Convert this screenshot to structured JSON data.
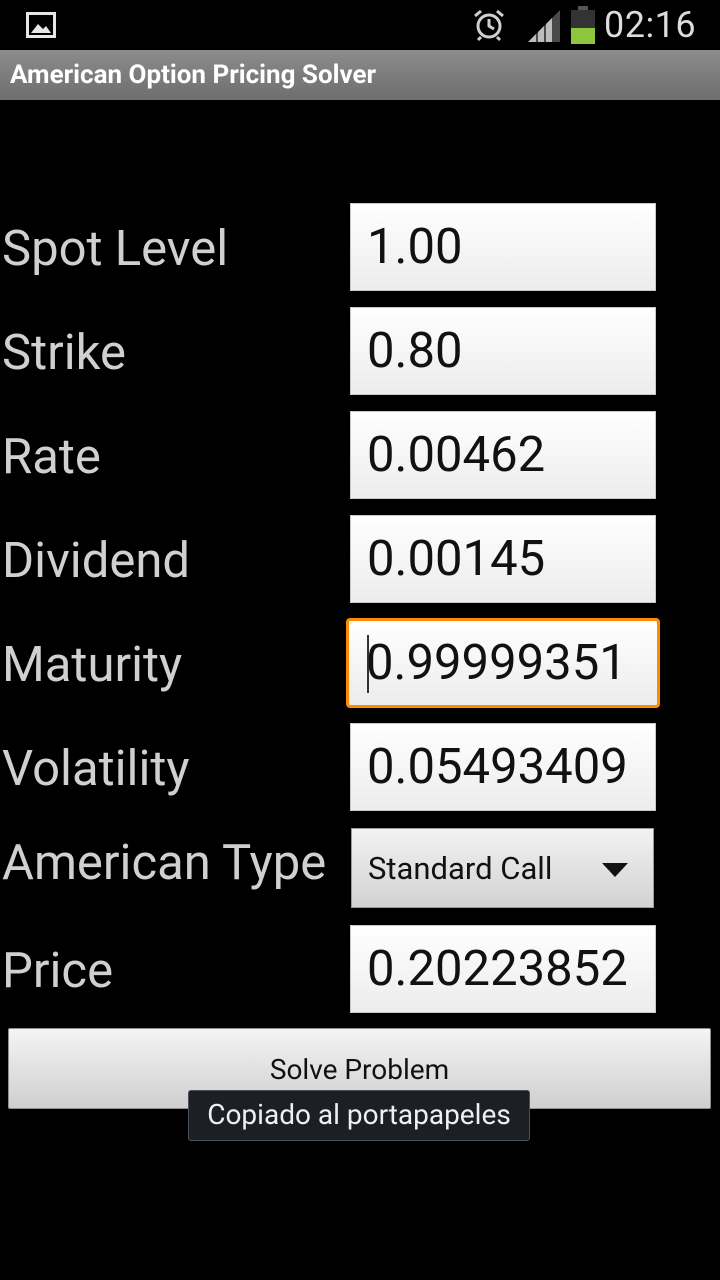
{
  "status_bar": {
    "time": "02:16",
    "icons": [
      "gallery-icon",
      "alarm-icon",
      "signal-icon",
      "battery-icon"
    ],
    "battery_color": "#8cc63f"
  },
  "app": {
    "title": "American Option Pricing Solver"
  },
  "form": {
    "spot_level": {
      "label": "Spot Level",
      "value": "1.00"
    },
    "strike": {
      "label": "Strike",
      "value": "0.80"
    },
    "rate": {
      "label": "Rate",
      "value": "0.00462"
    },
    "dividend": {
      "label": "Dividend",
      "value": "0.00145"
    },
    "maturity": {
      "label": "Maturity",
      "value": "0.99999351",
      "focused": true
    },
    "volatility": {
      "label": "Volatility",
      "value": "0.05493409"
    },
    "american_type": {
      "label": "American Type",
      "selected": "Standard Call"
    },
    "price": {
      "label": "Price",
      "value": "0.20223852"
    }
  },
  "actions": {
    "solve_label": "Solve Problem"
  },
  "toast": {
    "message": "Copiado al portapapeles"
  },
  "colors": {
    "focus_accent": "#ff8a00",
    "title_bar": "#7d7d7d",
    "background": "#000000"
  }
}
